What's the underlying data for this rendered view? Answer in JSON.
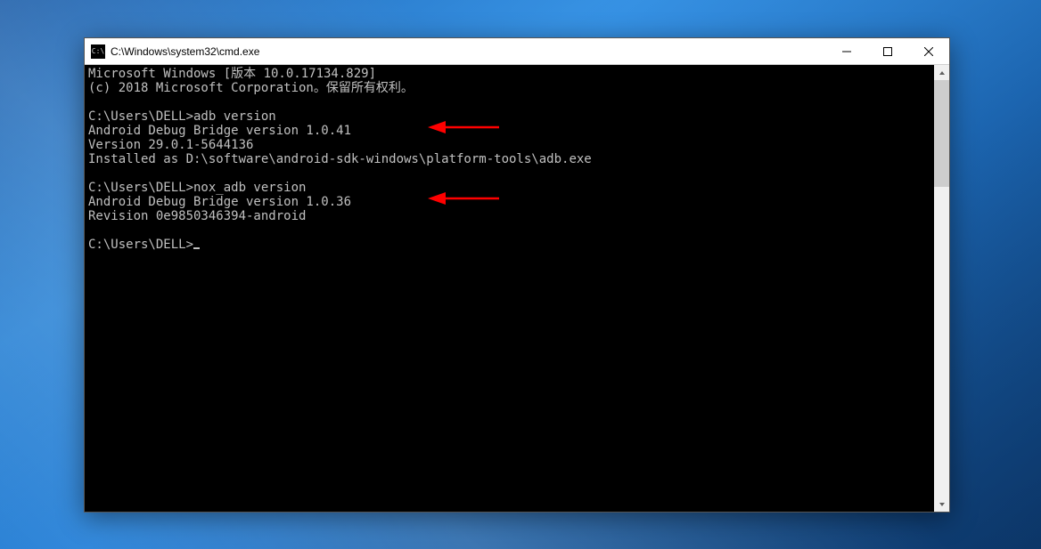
{
  "window": {
    "title": "C:\\Windows\\system32\\cmd.exe",
    "icon_label": "C:\\"
  },
  "console": {
    "lines": [
      "Microsoft Windows [版本 10.0.17134.829]",
      "(c) 2018 Microsoft Corporation。保留所有权利。",
      "",
      "C:\\Users\\DELL>adb version",
      "Android Debug Bridge version 1.0.41",
      "Version 29.0.1-5644136",
      "Installed as D:\\software\\android-sdk-windows\\platform-tools\\adb.exe",
      "",
      "C:\\Users\\DELL>nox_adb version",
      "Android Debug Bridge version 1.0.36",
      "Revision 0e9850346394-android",
      "",
      "C:\\Users\\DELL>"
    ]
  },
  "annotations": {
    "arrow1_target": "Android Debug Bridge version 1.0.41",
    "arrow2_target": "Android Debug Bridge version 1.0.36"
  }
}
